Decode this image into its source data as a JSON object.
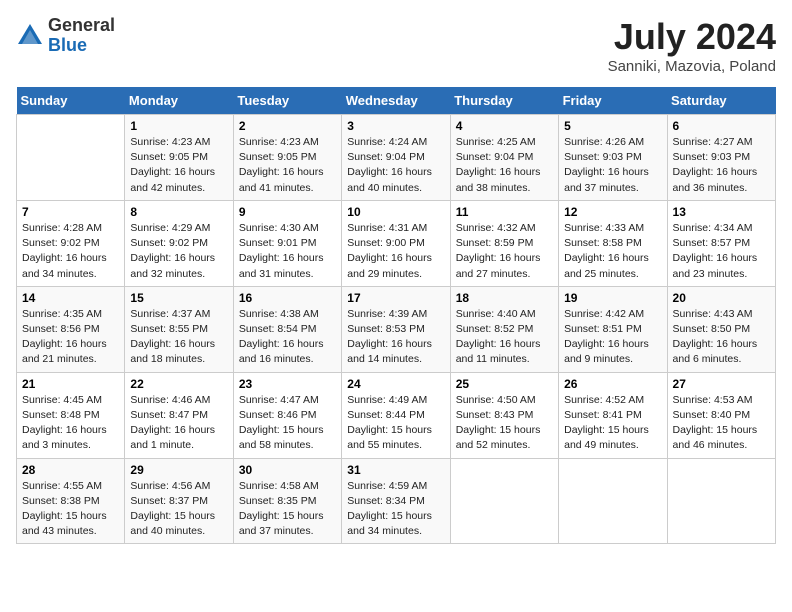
{
  "header": {
    "logo_line1": "General",
    "logo_line2": "Blue",
    "month": "July 2024",
    "location": "Sanniki, Mazovia, Poland"
  },
  "weekdays": [
    "Sunday",
    "Monday",
    "Tuesday",
    "Wednesday",
    "Thursday",
    "Friday",
    "Saturday"
  ],
  "weeks": [
    [
      {
        "day": "",
        "info": ""
      },
      {
        "day": "1",
        "info": "Sunrise: 4:23 AM\nSunset: 9:05 PM\nDaylight: 16 hours\nand 42 minutes."
      },
      {
        "day": "2",
        "info": "Sunrise: 4:23 AM\nSunset: 9:05 PM\nDaylight: 16 hours\nand 41 minutes."
      },
      {
        "day": "3",
        "info": "Sunrise: 4:24 AM\nSunset: 9:04 PM\nDaylight: 16 hours\nand 40 minutes."
      },
      {
        "day": "4",
        "info": "Sunrise: 4:25 AM\nSunset: 9:04 PM\nDaylight: 16 hours\nand 38 minutes."
      },
      {
        "day": "5",
        "info": "Sunrise: 4:26 AM\nSunset: 9:03 PM\nDaylight: 16 hours\nand 37 minutes."
      },
      {
        "day": "6",
        "info": "Sunrise: 4:27 AM\nSunset: 9:03 PM\nDaylight: 16 hours\nand 36 minutes."
      }
    ],
    [
      {
        "day": "7",
        "info": "Sunrise: 4:28 AM\nSunset: 9:02 PM\nDaylight: 16 hours\nand 34 minutes."
      },
      {
        "day": "8",
        "info": "Sunrise: 4:29 AM\nSunset: 9:02 PM\nDaylight: 16 hours\nand 32 minutes."
      },
      {
        "day": "9",
        "info": "Sunrise: 4:30 AM\nSunset: 9:01 PM\nDaylight: 16 hours\nand 31 minutes."
      },
      {
        "day": "10",
        "info": "Sunrise: 4:31 AM\nSunset: 9:00 PM\nDaylight: 16 hours\nand 29 minutes."
      },
      {
        "day": "11",
        "info": "Sunrise: 4:32 AM\nSunset: 8:59 PM\nDaylight: 16 hours\nand 27 minutes."
      },
      {
        "day": "12",
        "info": "Sunrise: 4:33 AM\nSunset: 8:58 PM\nDaylight: 16 hours\nand 25 minutes."
      },
      {
        "day": "13",
        "info": "Sunrise: 4:34 AM\nSunset: 8:57 PM\nDaylight: 16 hours\nand 23 minutes."
      }
    ],
    [
      {
        "day": "14",
        "info": "Sunrise: 4:35 AM\nSunset: 8:56 PM\nDaylight: 16 hours\nand 21 minutes."
      },
      {
        "day": "15",
        "info": "Sunrise: 4:37 AM\nSunset: 8:55 PM\nDaylight: 16 hours\nand 18 minutes."
      },
      {
        "day": "16",
        "info": "Sunrise: 4:38 AM\nSunset: 8:54 PM\nDaylight: 16 hours\nand 16 minutes."
      },
      {
        "day": "17",
        "info": "Sunrise: 4:39 AM\nSunset: 8:53 PM\nDaylight: 16 hours\nand 14 minutes."
      },
      {
        "day": "18",
        "info": "Sunrise: 4:40 AM\nSunset: 8:52 PM\nDaylight: 16 hours\nand 11 minutes."
      },
      {
        "day": "19",
        "info": "Sunrise: 4:42 AM\nSunset: 8:51 PM\nDaylight: 16 hours\nand 9 minutes."
      },
      {
        "day": "20",
        "info": "Sunrise: 4:43 AM\nSunset: 8:50 PM\nDaylight: 16 hours\nand 6 minutes."
      }
    ],
    [
      {
        "day": "21",
        "info": "Sunrise: 4:45 AM\nSunset: 8:48 PM\nDaylight: 16 hours\nand 3 minutes."
      },
      {
        "day": "22",
        "info": "Sunrise: 4:46 AM\nSunset: 8:47 PM\nDaylight: 16 hours\nand 1 minute."
      },
      {
        "day": "23",
        "info": "Sunrise: 4:47 AM\nSunset: 8:46 PM\nDaylight: 15 hours\nand 58 minutes."
      },
      {
        "day": "24",
        "info": "Sunrise: 4:49 AM\nSunset: 8:44 PM\nDaylight: 15 hours\nand 55 minutes."
      },
      {
        "day": "25",
        "info": "Sunrise: 4:50 AM\nSunset: 8:43 PM\nDaylight: 15 hours\nand 52 minutes."
      },
      {
        "day": "26",
        "info": "Sunrise: 4:52 AM\nSunset: 8:41 PM\nDaylight: 15 hours\nand 49 minutes."
      },
      {
        "day": "27",
        "info": "Sunrise: 4:53 AM\nSunset: 8:40 PM\nDaylight: 15 hours\nand 46 minutes."
      }
    ],
    [
      {
        "day": "28",
        "info": "Sunrise: 4:55 AM\nSunset: 8:38 PM\nDaylight: 15 hours\nand 43 minutes."
      },
      {
        "day": "29",
        "info": "Sunrise: 4:56 AM\nSunset: 8:37 PM\nDaylight: 15 hours\nand 40 minutes."
      },
      {
        "day": "30",
        "info": "Sunrise: 4:58 AM\nSunset: 8:35 PM\nDaylight: 15 hours\nand 37 minutes."
      },
      {
        "day": "31",
        "info": "Sunrise: 4:59 AM\nSunset: 8:34 PM\nDaylight: 15 hours\nand 34 minutes."
      },
      {
        "day": "",
        "info": ""
      },
      {
        "day": "",
        "info": ""
      },
      {
        "day": "",
        "info": ""
      }
    ]
  ]
}
